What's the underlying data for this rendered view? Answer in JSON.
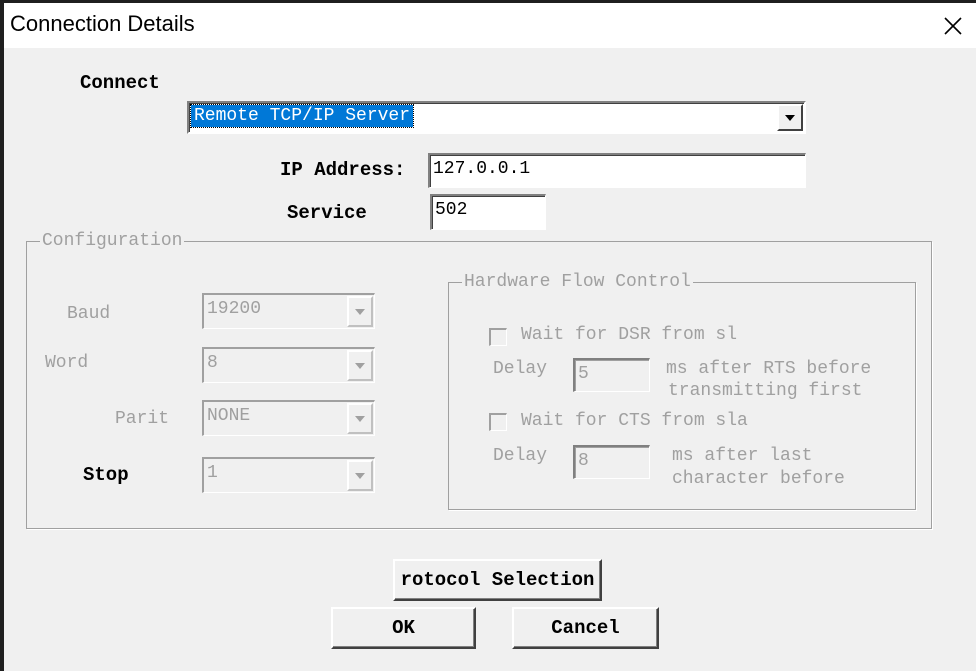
{
  "window": {
    "title": "Connection Details"
  },
  "connect": {
    "label": "Connect",
    "selected": "Remote TCP/IP Server",
    "ip_label": "IP Address:",
    "ip_value": "127.0.0.1",
    "service_label": "Service",
    "service_value": "502"
  },
  "configuration": {
    "title": "Configuration",
    "baud_label": "Baud",
    "baud_value": "19200",
    "word_label": "Word",
    "word_value": "8",
    "parity_label": "Parit",
    "parity_value": "NONE",
    "stop_label": "Stop",
    "stop_value": "1",
    "hardware_flow": {
      "title": "Hardware Flow Control",
      "dsr_label": "Wait for DSR from sl",
      "delay1_label": "Delay",
      "delay1_value": "5",
      "delay1_note_line1": "ms after RTS before",
      "delay1_note_line2": "transmitting first",
      "cts_label": "Wait for CTS from sla",
      "delay2_label": "Delay",
      "delay2_value": "8",
      "delay2_note_line1": "ms after last",
      "delay2_note_line2": "character before"
    }
  },
  "buttons": {
    "protocol_label": "rotocol Selection",
    "ok_label": "OK",
    "cancel_label": "Cancel"
  },
  "icons": {
    "close": "close-icon",
    "dropdown": "chevron-down-icon"
  }
}
